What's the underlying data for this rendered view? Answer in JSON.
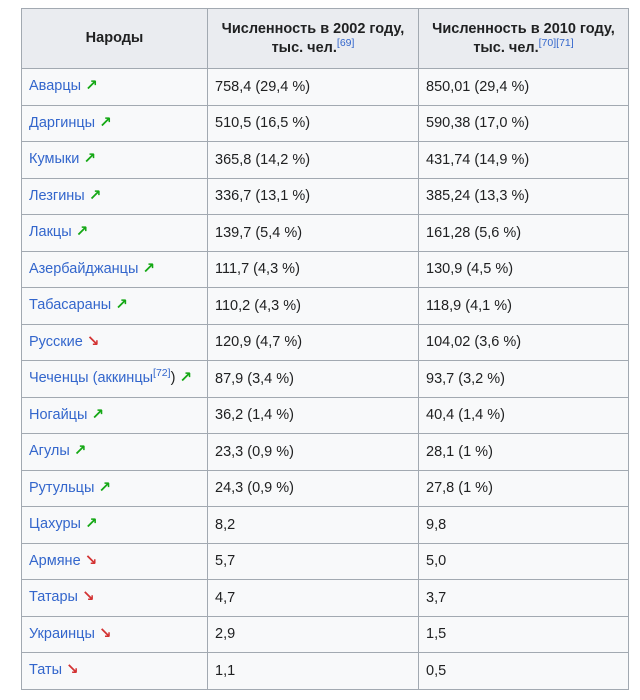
{
  "table": {
    "headers": {
      "people": "Народы",
      "y2002": "Численность в 2002 году, тыс. чел.",
      "y2002_ref": "[69]",
      "y2010": "Численность в 2010 году, тыс. чел.",
      "y2010_ref1": "[70]",
      "y2010_ref2": "[71]"
    },
    "rows": [
      {
        "name": "Аварцы",
        "ref": "",
        "suffix": "",
        "trend": "up",
        "trend_icon": "↗",
        "v2002": "758,4 (29,4 %)",
        "v2010": "850,01 (29,4 %)"
      },
      {
        "name": "Даргинцы",
        "ref": "",
        "suffix": "",
        "trend": "up",
        "trend_icon": "↗",
        "v2002": "510,5 (16,5 %)",
        "v2010": "590,38 (17,0 %)"
      },
      {
        "name": "Кумыки",
        "ref": "",
        "suffix": "",
        "trend": "up",
        "trend_icon": "↗",
        "v2002": "365,8 (14,2 %)",
        "v2010": "431,74 (14,9 %)"
      },
      {
        "name": "Лезгины",
        "ref": "",
        "suffix": "",
        "trend": "up",
        "trend_icon": "↗",
        "v2002": "336,7 (13,1 %)",
        "v2010": "385,24 (13,3 %)"
      },
      {
        "name": "Лакцы",
        "ref": "",
        "suffix": "",
        "trend": "up",
        "trend_icon": "↗",
        "v2002": "139,7 (5,4 %)",
        "v2010": "161,28 (5,6 %)"
      },
      {
        "name": "Азербайджанцы",
        "ref": "",
        "suffix": "",
        "trend": "up",
        "trend_icon": "↗",
        "v2002": "111,7 (4,3 %)",
        "v2010": "130,9 (4,5 %)"
      },
      {
        "name": "Табасараны",
        "ref": "",
        "suffix": "",
        "trend": "up",
        "trend_icon": "↗",
        "v2002": "110,2 (4,3 %)",
        "v2010": "118,9 (4,1 %)"
      },
      {
        "name": "Русские",
        "ref": "",
        "suffix": "",
        "trend": "down",
        "trend_icon": "↘",
        "v2002": "120,9 (4,7 %)",
        "v2010": "104,02 (3,6 %)"
      },
      {
        "name": "Чеченцы (аккинцы",
        "ref": "[72]",
        "suffix": ")",
        "trend": "up",
        "trend_icon": "↗",
        "v2002": "87,9 (3,4 %)",
        "v2010": "93,7 (3,2 %)"
      },
      {
        "name": "Ногайцы",
        "ref": "",
        "suffix": "",
        "trend": "up",
        "trend_icon": "↗",
        "v2002": "36,2 (1,4 %)",
        "v2010": "40,4 (1,4 %)"
      },
      {
        "name": "Агулы",
        "ref": "",
        "suffix": "",
        "trend": "up",
        "trend_icon": "↗",
        "v2002": "23,3 (0,9 %)",
        "v2010": "28,1 (1 %)"
      },
      {
        "name": "Рутульцы",
        "ref": "",
        "suffix": "",
        "trend": "up",
        "trend_icon": "↗",
        "v2002": "24,3 (0,9 %)",
        "v2010": "27,8 (1 %)"
      },
      {
        "name": "Цахуры",
        "ref": "",
        "suffix": "",
        "trend": "up",
        "trend_icon": "↗",
        "v2002": "8,2",
        "v2010": "9,8"
      },
      {
        "name": "Армяне",
        "ref": "",
        "suffix": "",
        "trend": "down",
        "trend_icon": "↘",
        "v2002": "5,7",
        "v2010": "5,0"
      },
      {
        "name": "Татары",
        "ref": "",
        "suffix": "",
        "trend": "down",
        "trend_icon": "↘",
        "v2002": "4,7",
        "v2010": "3,7"
      },
      {
        "name": "Украинцы",
        "ref": "",
        "suffix": "",
        "trend": "down",
        "trend_icon": "↘",
        "v2002": "2,9",
        "v2010": "1,5"
      },
      {
        "name": "Таты",
        "ref": "",
        "suffix": "",
        "trend": "down",
        "trend_icon": "↘",
        "v2002": "1,1",
        "v2010": "0,5"
      }
    ]
  },
  "colors": {
    "link": "#3366cc",
    "trend_up": "#14a814",
    "trend_down": "#d33333",
    "header_bg": "#eaecf0",
    "cell_bg": "#f8f9fa",
    "border": "#a2a9b1"
  }
}
